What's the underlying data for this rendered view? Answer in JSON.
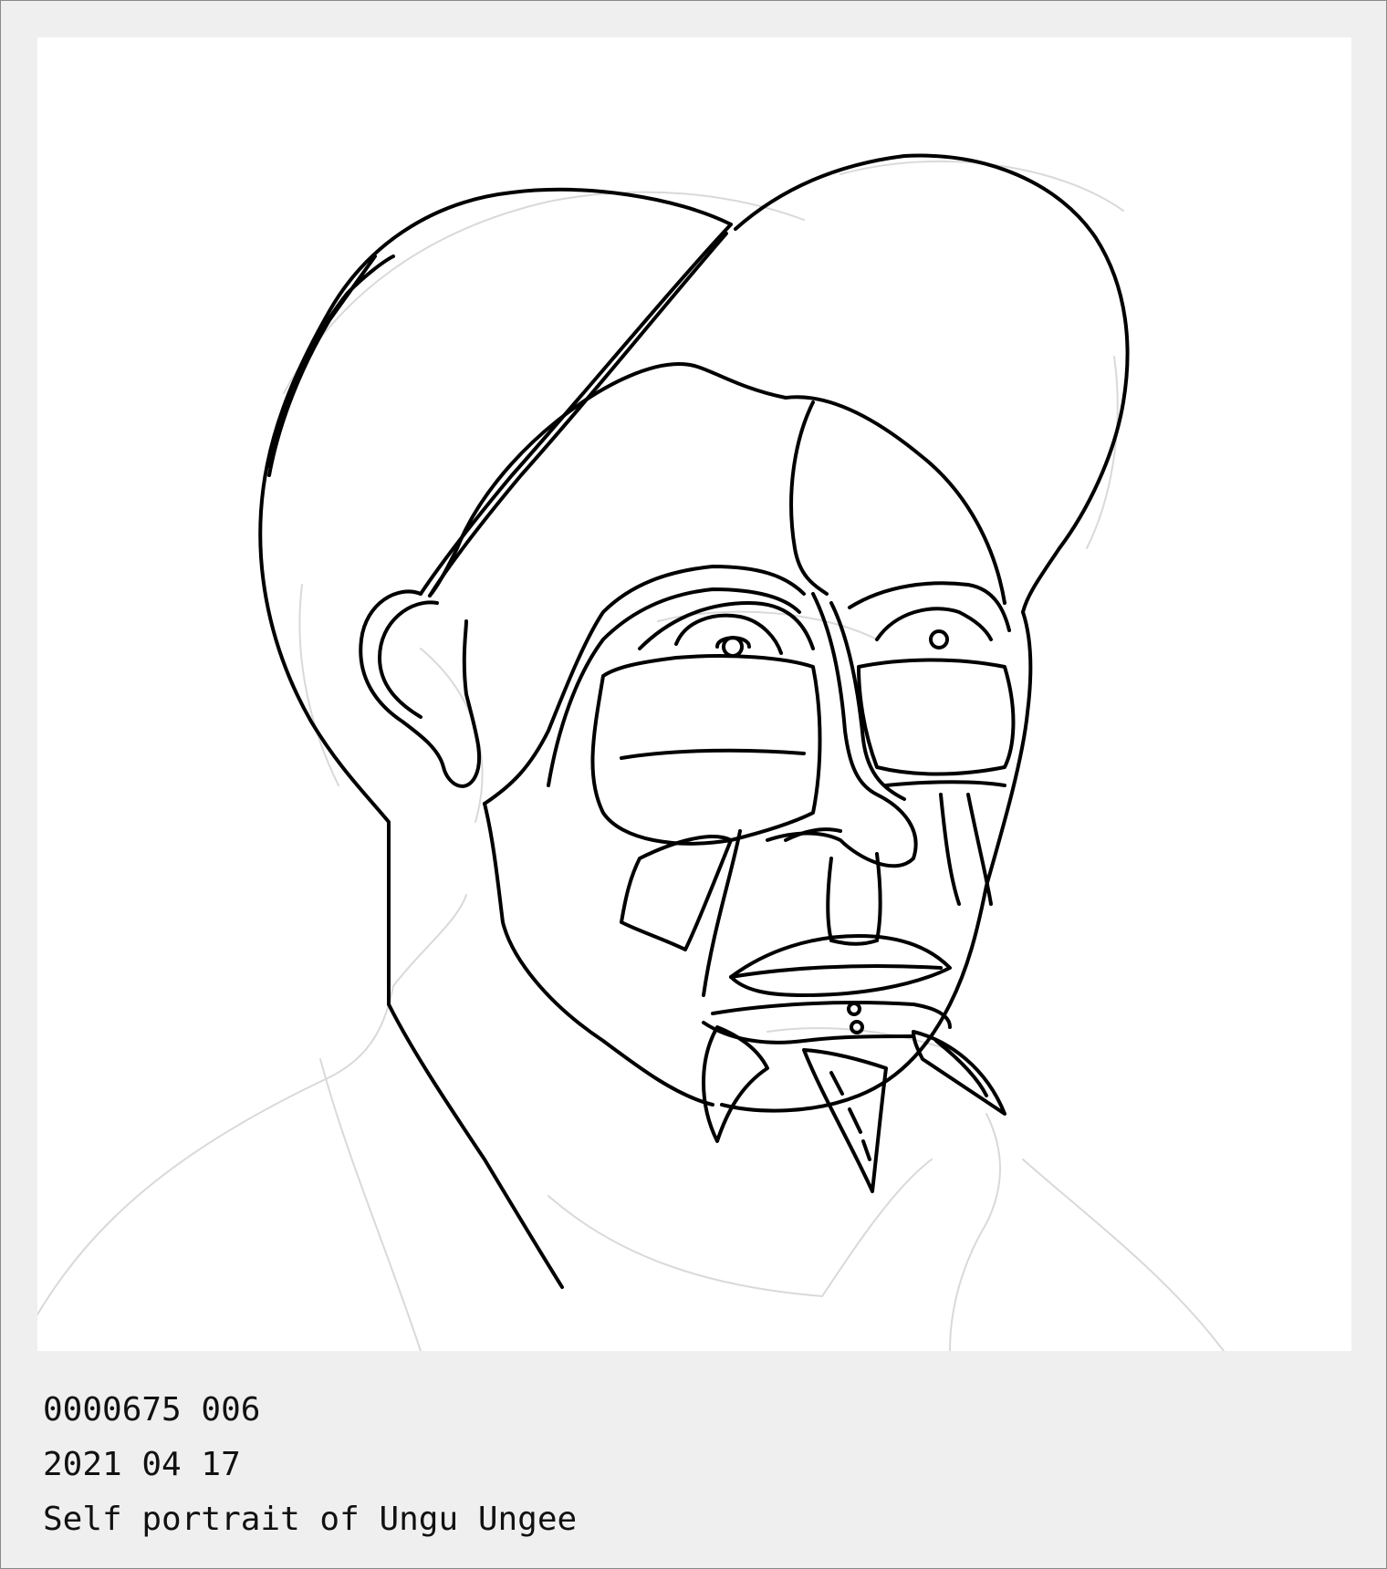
{
  "caption": {
    "id_line": "0000675 006",
    "date_line": "2021 04 17",
    "title_line": "Self portrait of Ungu Ungee"
  },
  "artwork": {
    "style": "black line drawing over faint grey sketch guidelines",
    "ink_color": "#000000",
    "sketch_color": "#d9d9d9",
    "background_color": "#ffffff"
  }
}
